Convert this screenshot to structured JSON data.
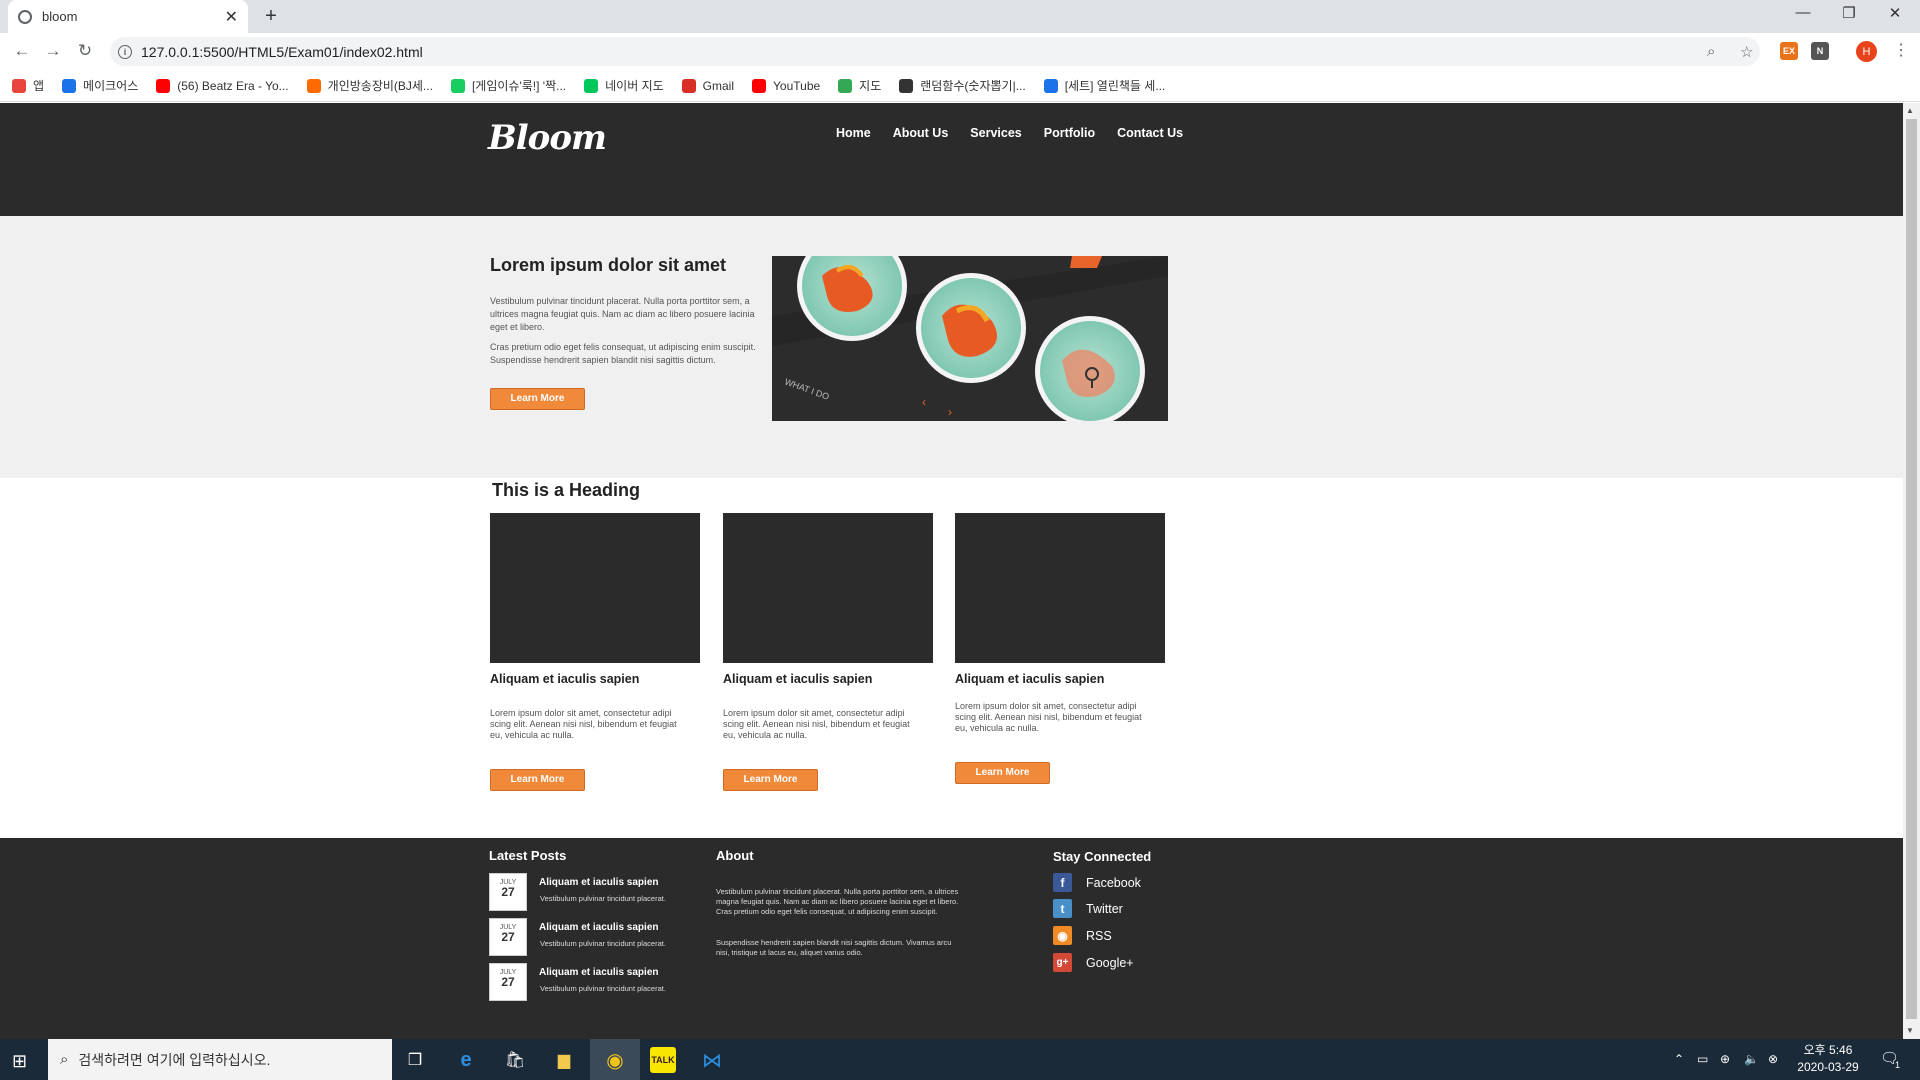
{
  "browser": {
    "tab_title": "bloom",
    "url": "127.0.0.1:5500/HTML5/Exam01/index02.html",
    "bookmarks": [
      {
        "label": "앱",
        "icon": "apps-grid-icon",
        "color": "#e8453c"
      },
      {
        "label": "메이크어스",
        "icon": "chat-bubble-icon",
        "color": "#1a73e8"
      },
      {
        "label": "(56) Beatz Era - Yo...",
        "icon": "youtube-icon",
        "color": "#ff0000"
      },
      {
        "label": "개인방송장비(BJ세...",
        "icon": "k-logo-icon",
        "color": "#ff6a00"
      },
      {
        "label": "[게임이슈'룩!] '짝...",
        "icon": "g-logo-icon",
        "color": "#19ce60"
      },
      {
        "label": "네이버 지도",
        "icon": "naver-n-icon",
        "color": "#03c75a"
      },
      {
        "label": "Gmail",
        "icon": "gmail-icon",
        "color": "#d93025"
      },
      {
        "label": "YouTube",
        "icon": "youtube-icon",
        "color": "#ff0000"
      },
      {
        "label": "지도",
        "icon": "maps-icon",
        "color": "#34a853"
      },
      {
        "label": "랜덤함수(숫자뽑기|...",
        "icon": "dots-icon",
        "color": "#333333"
      },
      {
        "label": "[세트] 열린책들 세...",
        "icon": "smile-icon",
        "color": "#1a73e8"
      }
    ],
    "avatar_letter": "H"
  },
  "site": {
    "logo": "Bloom",
    "nav": [
      "Home",
      "About Us",
      "Services",
      "Portfolio",
      "Contact Us"
    ],
    "hero": {
      "title": "Lorem ipsum dolor sit amet",
      "p1": "Vestibulum pulvinar tincidunt placerat. Nulla porta porttitor sem, a ultrices magna feugiat quis. Nam ac diam ac libero posuere lacinia eget et libero.",
      "p2": "Cras pretium odio eget felis consequat, ut adipiscing enim suscipit. Suspendisse hendrerit sapien blandit nisi sagittis dictum.",
      "button": "Learn More",
      "image_text": "WHAT I DO"
    },
    "section_heading": "This is a Heading",
    "cards": [
      {
        "title": "Aliquam et iaculis sapien",
        "text": "Lorem ipsum dolor sit amet, consectetur adipi scing elit. Aenean nisi nisl, bibendum et feugiat eu, vehicula ac nulla.",
        "button": "Learn More"
      },
      {
        "title": "Aliquam et iaculis sapien",
        "text": "Lorem ipsum dolor sit amet, consectetur adipi scing elit. Aenean nisi nisl, bibendum et feugiat eu, vehicula ac nulla.",
        "button": "Learn More"
      },
      {
        "title": "Aliquam et iaculis sapien",
        "text": "Lorem ipsum dolor sit amet, consectetur adipi scing elit. Aenean nisi nisl, bibendum et feugiat eu, vehicula ac nulla.",
        "button": "Learn More"
      }
    ],
    "footer": {
      "latest_heading": "Latest Posts",
      "posts": [
        {
          "month": "JULY",
          "day": "27",
          "title": "Aliquam et iaculis sapien",
          "sub": "Vestibulum pulvinar tincidunt placerat."
        },
        {
          "month": "JULY",
          "day": "27",
          "title": "Aliquam et iaculis sapien",
          "sub": "Vestibulum pulvinar tincidunt placerat."
        },
        {
          "month": "JULY",
          "day": "27",
          "title": "Aliquam et iaculis sapien",
          "sub": "Vestibulum pulvinar tincidunt placerat."
        }
      ],
      "about_heading": "About",
      "about_p1": "Vestibulum pulvinar tincidunt placerat. Nulla porta porttitor sem, a ultrices magna feugiat quis. Nam ac diam ac libero posuere lacinia eget et libero. Cras pretium odio eget felis consequat, ut adipiscing enim suscipit.",
      "about_p2": "Suspendisse hendrerit sapien blandit nisi sagittis dictum. Vivamus arcu nisi, tristique ut lacus eu, aliquet varius odio.",
      "stay_heading": "Stay Connected",
      "social": [
        {
          "label": "Facebook",
          "icon": "facebook-icon",
          "glyph": "f",
          "color": "#3b5998"
        },
        {
          "label": "Twitter",
          "icon": "twitter-icon",
          "glyph": "t",
          "color": "#4a90c8"
        },
        {
          "label": "RSS",
          "icon": "rss-icon",
          "glyph": "◉",
          "color": "#f08a24"
        },
        {
          "label": "Google+",
          "icon": "google-plus-icon",
          "glyph": "g+",
          "color": "#d34836"
        }
      ]
    },
    "accent_color": "#f0893a"
  },
  "taskbar": {
    "search_placeholder": "검색하려면 여기에 입력하십시오.",
    "time": "오후 5:46",
    "date": "2020-03-29",
    "notification_count": "1"
  }
}
